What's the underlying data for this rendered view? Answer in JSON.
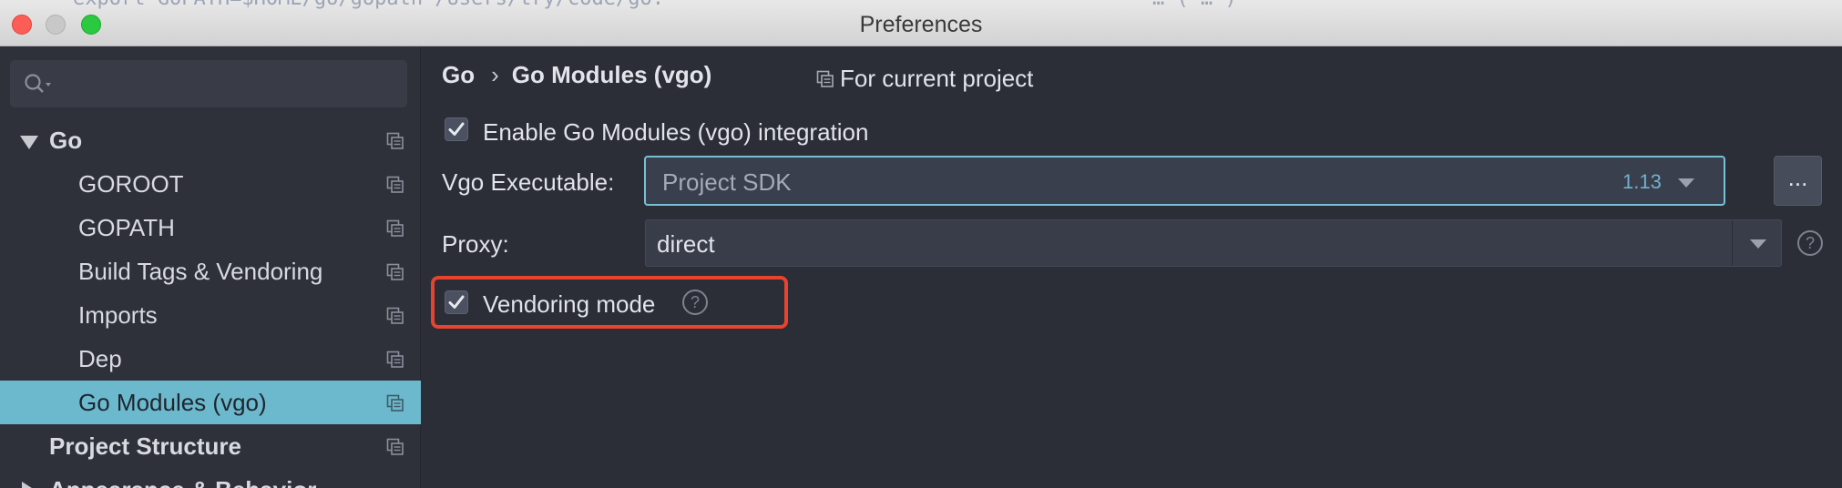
{
  "window": {
    "title": "Preferences",
    "behind_text": "export GOPATH=$HOME/go/gopath /Users/try/code/go:",
    "behind_text_right": "…  (  …  )"
  },
  "sidebar": {
    "search_placeholder": "",
    "items": [
      {
        "label": "Go"
      },
      {
        "label": "GOROOT"
      },
      {
        "label": "GOPATH"
      },
      {
        "label": "Build Tags & Vendoring"
      },
      {
        "label": "Imports"
      },
      {
        "label": "Dep"
      },
      {
        "label": "Go Modules (vgo)"
      },
      {
        "label": "Project Structure"
      },
      {
        "label": "Appearance & Behavior"
      }
    ],
    "selected_item": "Go Modules (vgo)"
  },
  "content": {
    "breadcrumb": {
      "parent": "Go",
      "separator": "›",
      "current": "Go Modules (vgo)"
    },
    "scope_label": "For current project",
    "enable_checkbox": {
      "label": "Enable Go Modules (vgo) integration",
      "checked": true
    },
    "vgo_executable": {
      "label": "Vgo Executable:",
      "value": "Project SDK",
      "version": "1.13",
      "browse_label": "..."
    },
    "proxy": {
      "label": "Proxy:",
      "value": "direct"
    },
    "vendoring_checkbox": {
      "label": "Vendoring mode",
      "checked": true,
      "help": "?"
    },
    "proxy_help": "?"
  },
  "colors": {
    "accent": "#6cb8cc",
    "highlight_annotation": "#e8432e",
    "background": "#2b2d37"
  }
}
